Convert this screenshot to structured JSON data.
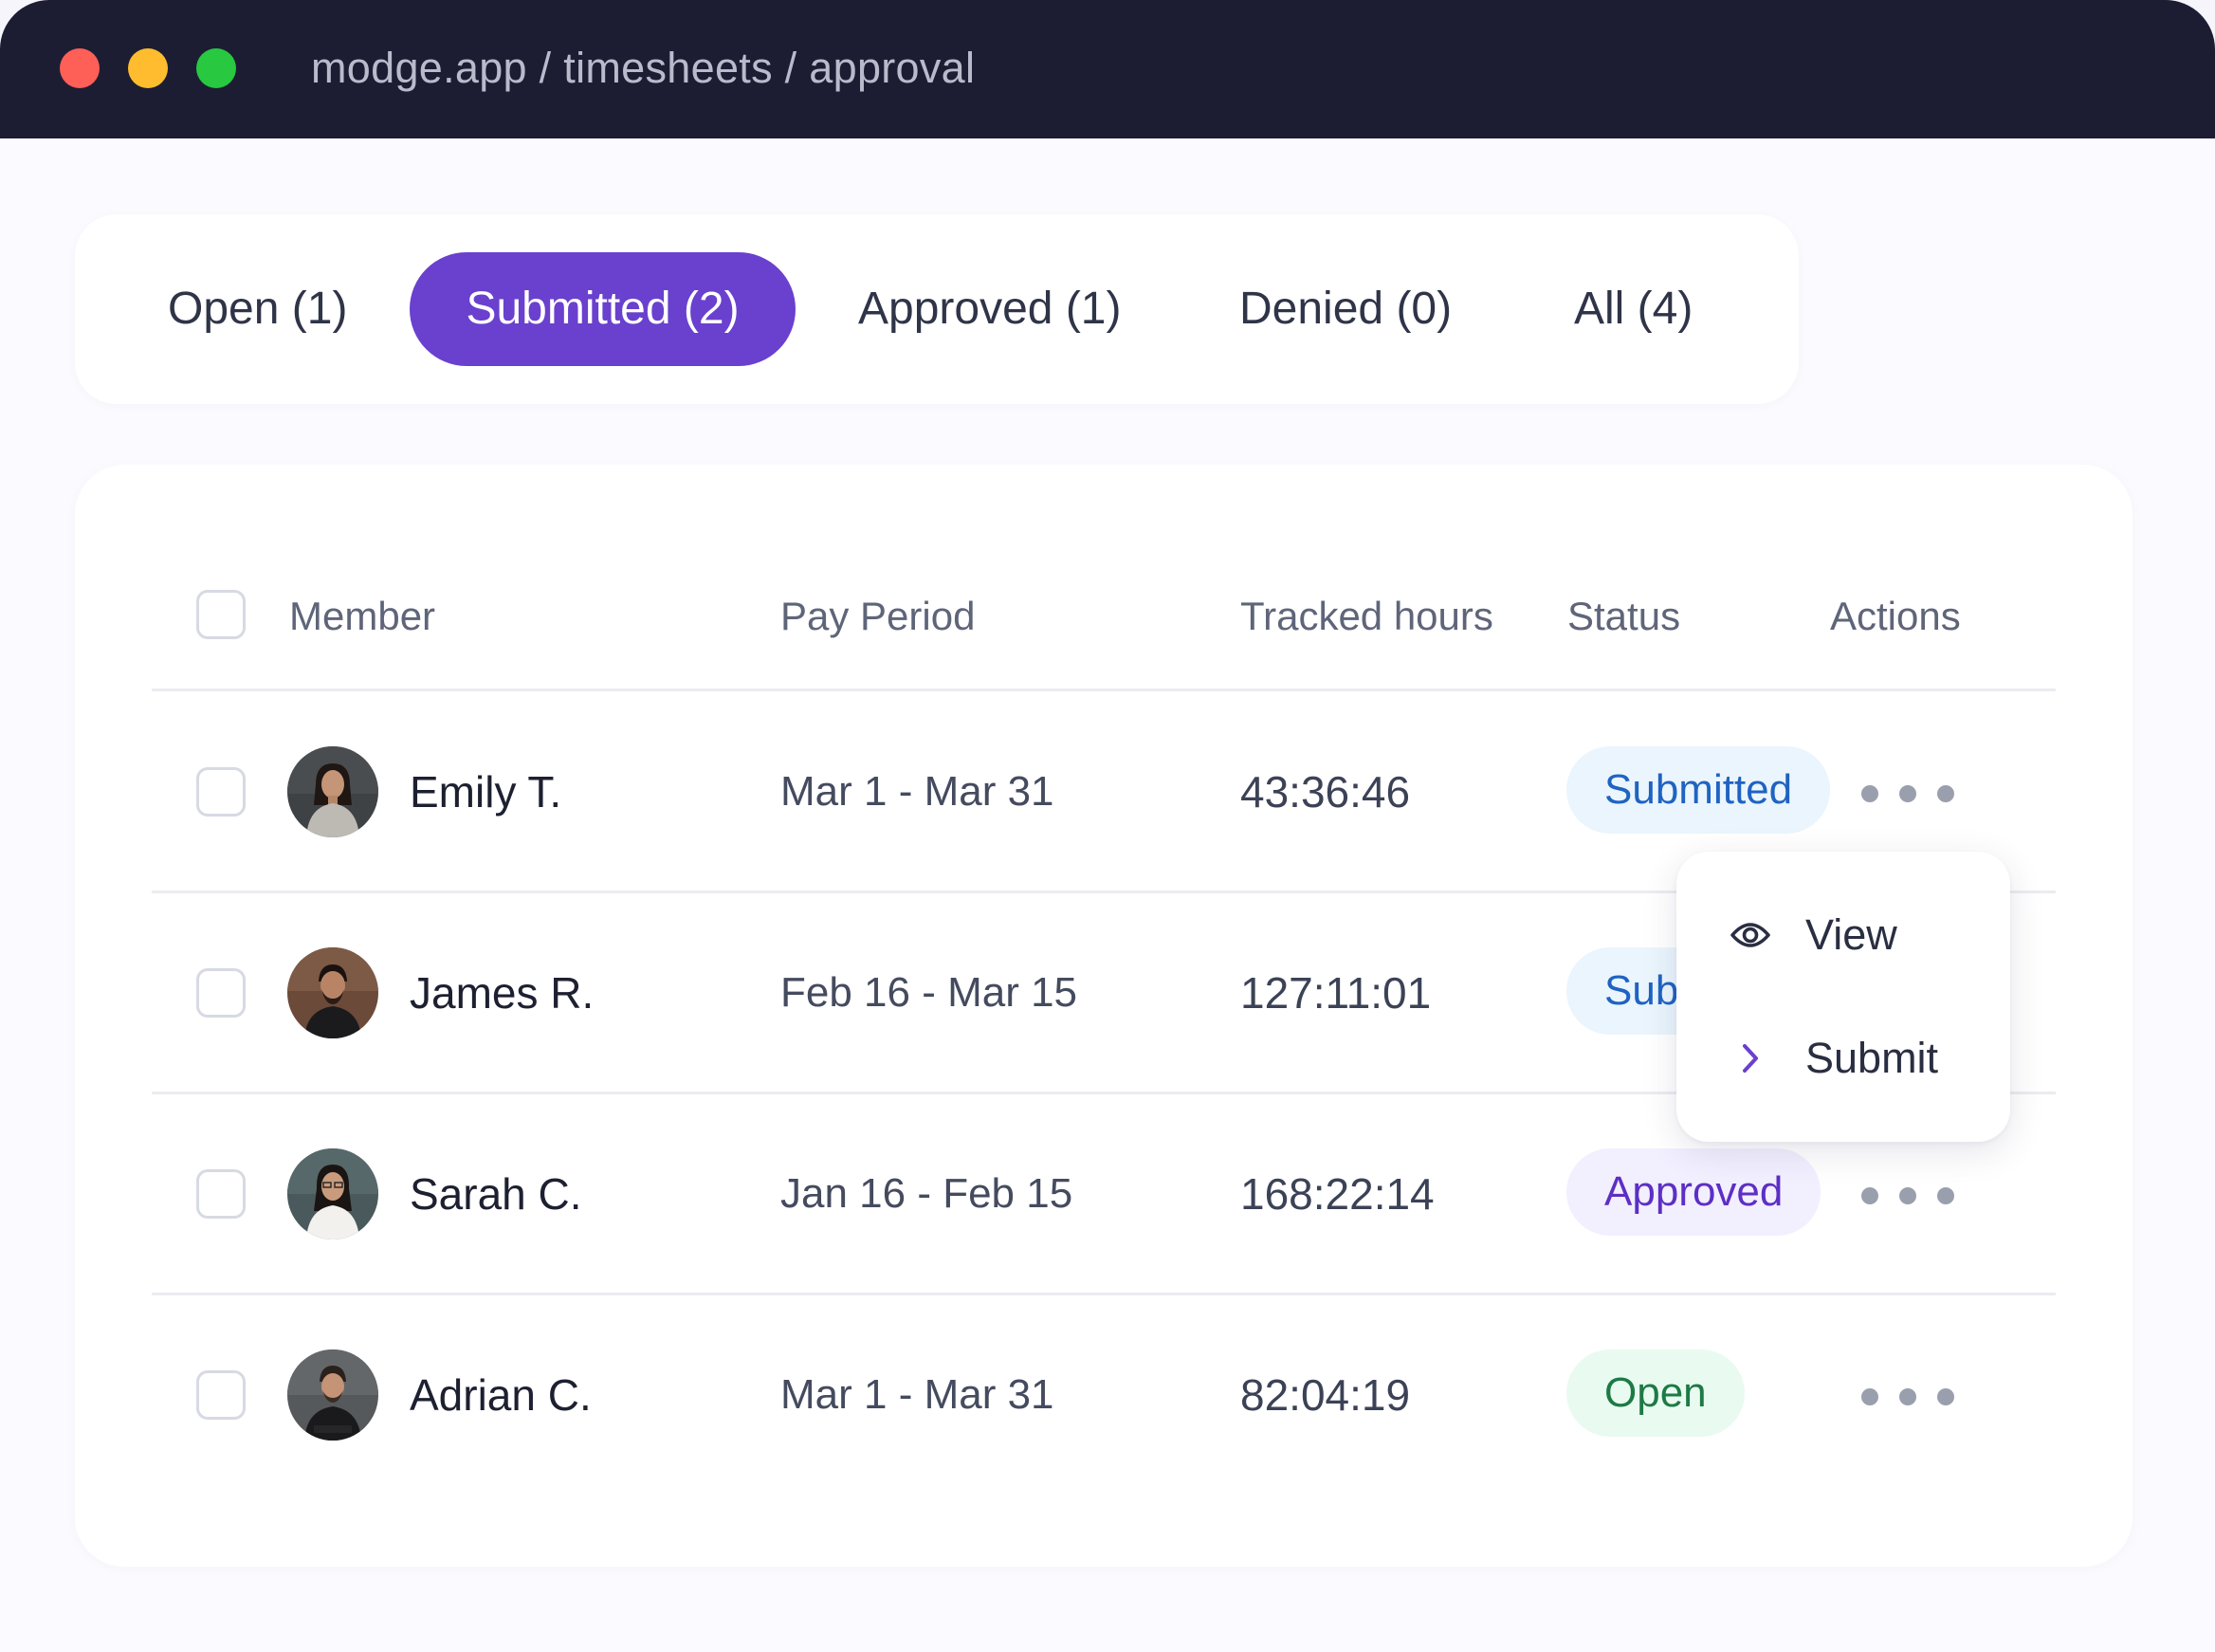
{
  "window": {
    "url": "modge.app / timesheets / approval"
  },
  "tabs": [
    {
      "label": "Open (1)",
      "active": false
    },
    {
      "label": "Submitted (2)",
      "active": true
    },
    {
      "label": "Approved (1)",
      "active": false
    },
    {
      "label": "Denied (0)",
      "active": false
    },
    {
      "label": "All (4)",
      "active": false
    }
  ],
  "table": {
    "headers": {
      "member": "Member",
      "pay_period": "Pay Period",
      "tracked_hours": "Tracked hours",
      "status": "Status",
      "actions": "Actions"
    },
    "rows": [
      {
        "name": "Emily T.",
        "pay_period": "Mar 1 - Mar 31",
        "tracked_hours": "43:36:46",
        "status": "Submitted"
      },
      {
        "name": "James R.",
        "pay_period": "Feb 16 - Mar 15",
        "tracked_hours": "127:11:01",
        "status": "Submitted"
      },
      {
        "name": "Sarah C.",
        "pay_period": "Jan 16 - Feb 15",
        "tracked_hours": "168:22:14",
        "status": "Approved"
      },
      {
        "name": "Adrian C.",
        "pay_period": "Mar 1 - Mar 31",
        "tracked_hours": "82:04:19",
        "status": "Open"
      }
    ]
  },
  "dropdown_menu": {
    "items": [
      {
        "label": "View",
        "icon": "eye-icon"
      },
      {
        "label": "Submit",
        "icon": "chevron-right-icon"
      }
    ]
  },
  "colors": {
    "titlebar": "#1c1d33",
    "accent": "#6a40ce",
    "submitted_text": "#1f63c2",
    "submitted_bg": "#eaf5fd",
    "approved_text": "#5d2fc4",
    "approved_bg": "#f2efff",
    "open_text": "#1d7a45",
    "open_bg": "#e9fbf0"
  }
}
